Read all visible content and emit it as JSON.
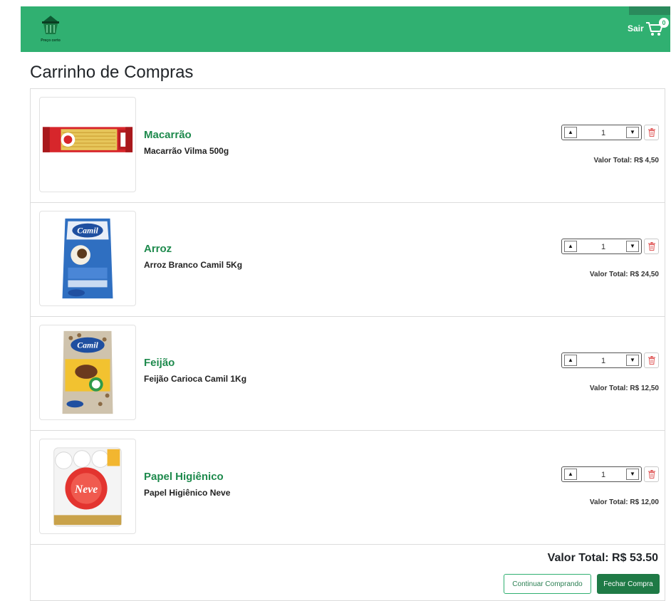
{
  "navbar": {
    "brand_text": "Preço certo",
    "logout_label": "Sair",
    "cart_count": "0",
    "color": "#30b071"
  },
  "page": {
    "title": "Carrinho de Compras"
  },
  "cart": {
    "items": [
      {
        "name": "Macarrão",
        "description": "Macarrão Vilma 500g",
        "quantity": "1",
        "total": "Valor Total: R$ 4,50",
        "image_icon": "pasta-package-icon"
      },
      {
        "name": "Arroz",
        "description": "Arroz Branco Camil 5Kg",
        "quantity": "1",
        "total": "Valor Total: R$ 24,50",
        "image_icon": "rice-bag-icon",
        "image_label": "Camil"
      },
      {
        "name": "Feijão",
        "description": "Feijão Carioca Camil 1Kg",
        "quantity": "1",
        "total": "Valor Total: R$ 12,50",
        "image_icon": "beans-bag-icon",
        "image_label": "Camil"
      },
      {
        "name": "Papel Higiênico",
        "description": "Papel Higiênico Neve",
        "quantity": "1",
        "total": "Valor Total: R$ 12,00",
        "image_icon": "toilet-paper-pack-icon",
        "image_label": "Neve"
      }
    ],
    "grand_total": "Valor Total: R$ 53.50",
    "continue_label": "Continuar Comprando",
    "checkout_label": "Fechar Compra"
  },
  "colors": {
    "brand_green": "#30b071",
    "name_green": "#1e8a4d",
    "checkout_green": "#1f7a46",
    "trash_red": "#e05a5a"
  }
}
